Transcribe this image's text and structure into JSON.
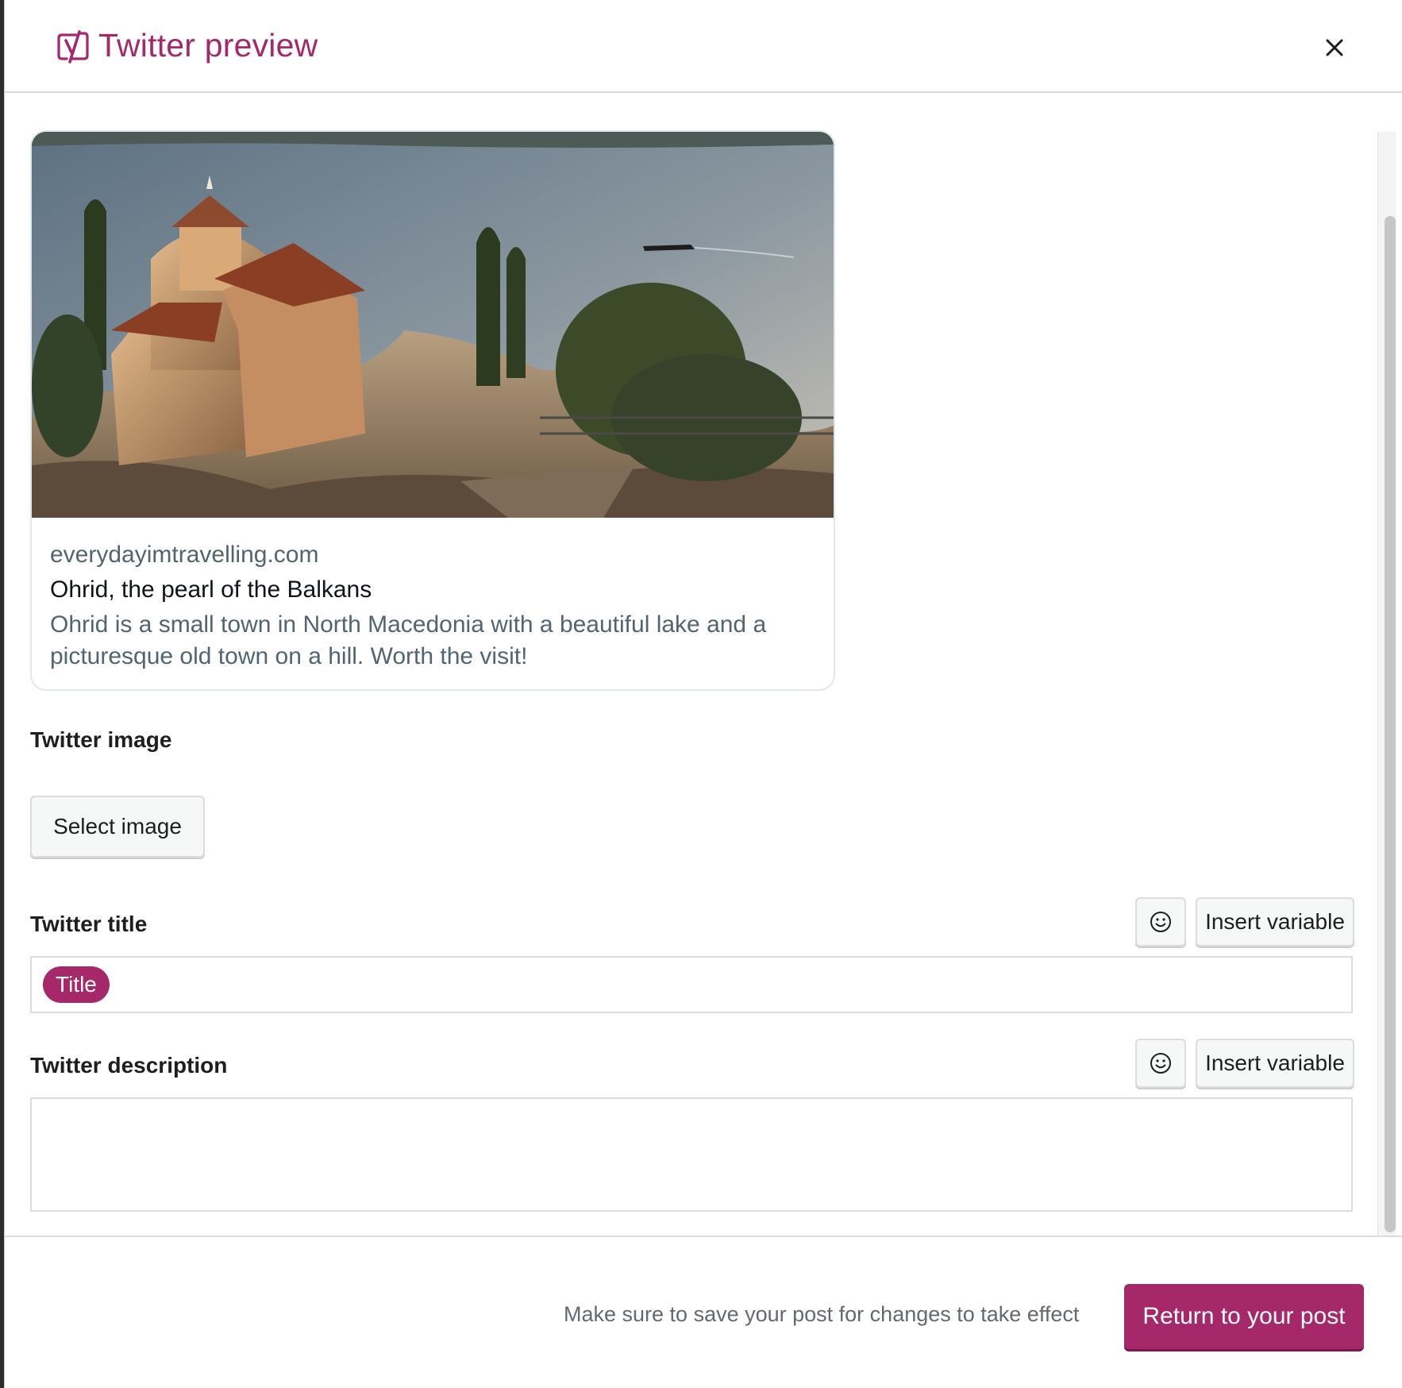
{
  "header": {
    "title": "Twitter preview",
    "logo_icon": "yoast-logo-icon",
    "close_icon": "close-icon"
  },
  "preview_card": {
    "image_alt": "Church of St. John at Kaneo overlooking Lake Ohrid",
    "domain": "everydayimtravelling.com",
    "headline": "Ohrid, the pearl of the Balkans",
    "description": "Ohrid is a small town in North Macedonia with a beautiful lake and a picturesque old town on a hill. Worth the visit!"
  },
  "twitter_image": {
    "label": "Twitter image",
    "select_button": "Select image"
  },
  "twitter_title": {
    "label": "Twitter title",
    "emoji_icon": "smiley-icon",
    "insert_variable": "Insert variable",
    "value_pill": "Title"
  },
  "twitter_description": {
    "label": "Twitter description",
    "emoji_icon": "smiley-icon",
    "insert_variable": "Insert variable",
    "value": ""
  },
  "footer": {
    "note": "Make sure to save your post for changes to take effect",
    "primary_button": "Return to your post"
  },
  "colors": {
    "brand": "#a4286a",
    "muted_text": "#536471",
    "border": "#dcdcde"
  }
}
